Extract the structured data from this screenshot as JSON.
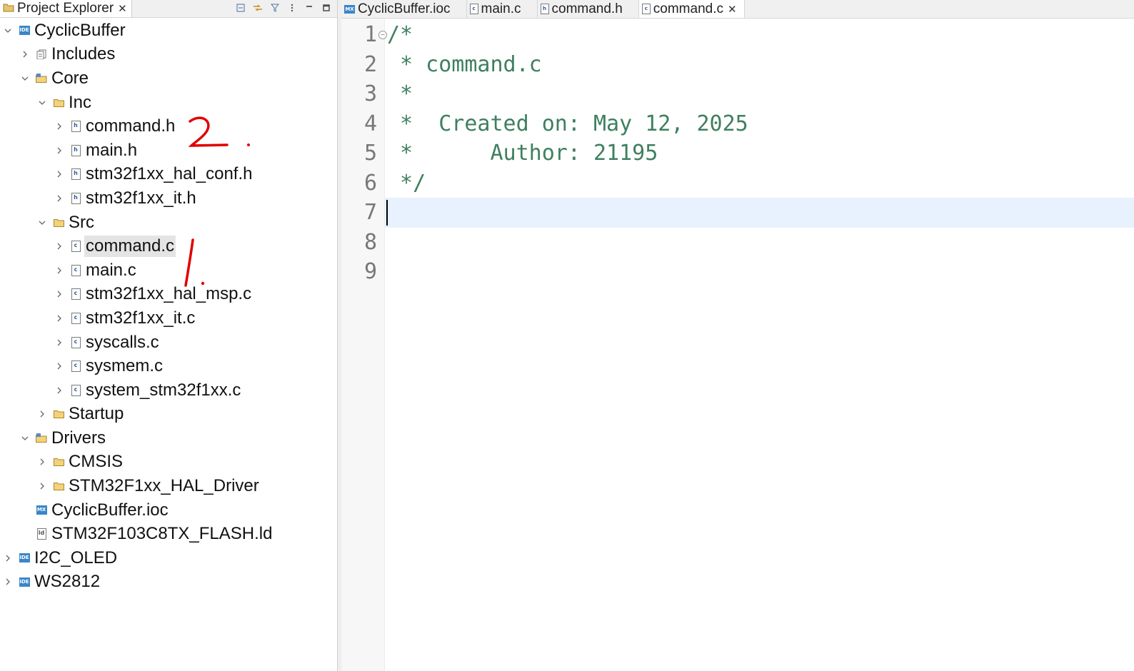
{
  "project_explorer": {
    "tab_label": "Project Explorer",
    "toolbar_icons": [
      "collapse-all-icon",
      "link-with-editor-icon",
      "filter-icon",
      "view-menu-icon",
      "minimize-icon",
      "maximize-icon"
    ],
    "tree": [
      {
        "label": "CyclicBuffer",
        "icon": "ide-project-icon",
        "expanded": true,
        "level": 0
      },
      {
        "label": "Includes",
        "icon": "includes-icon",
        "expanded": false,
        "level": 1
      },
      {
        "label": "Core",
        "icon": "source-folder-icon",
        "expanded": true,
        "level": 1
      },
      {
        "label": "Inc",
        "icon": "folder-icon",
        "expanded": true,
        "level": 2
      },
      {
        "label": "command.h",
        "icon": "header-file-icon",
        "expanded": false,
        "level": 3
      },
      {
        "label": "main.h",
        "icon": "header-file-icon",
        "expanded": false,
        "level": 3
      },
      {
        "label": "stm32f1xx_hal_conf.h",
        "icon": "header-file-icon",
        "expanded": false,
        "level": 3
      },
      {
        "label": "stm32f1xx_it.h",
        "icon": "header-file-icon",
        "expanded": false,
        "level": 3
      },
      {
        "label": "Src",
        "icon": "folder-icon",
        "expanded": true,
        "level": 2
      },
      {
        "label": "command.c",
        "icon": "c-file-icon",
        "expanded": false,
        "level": 3,
        "selected": true
      },
      {
        "label": "main.c",
        "icon": "c-file-icon",
        "expanded": false,
        "level": 3
      },
      {
        "label": "stm32f1xx_hal_msp.c",
        "icon": "c-file-icon",
        "expanded": false,
        "level": 3
      },
      {
        "label": "stm32f1xx_it.c",
        "icon": "c-file-icon",
        "expanded": false,
        "level": 3
      },
      {
        "label": "syscalls.c",
        "icon": "c-file-icon",
        "expanded": false,
        "level": 3
      },
      {
        "label": "sysmem.c",
        "icon": "c-file-icon",
        "expanded": false,
        "level": 3
      },
      {
        "label": "system_stm32f1xx.c",
        "icon": "c-file-icon",
        "expanded": false,
        "level": 3
      },
      {
        "label": "Startup",
        "icon": "folder-icon",
        "expanded": false,
        "level": 2
      },
      {
        "label": "Drivers",
        "icon": "source-folder-icon",
        "expanded": true,
        "level": 1
      },
      {
        "label": "CMSIS",
        "icon": "folder-icon",
        "expanded": false,
        "level": 2
      },
      {
        "label": "STM32F1xx_HAL_Driver",
        "icon": "folder-icon",
        "expanded": false,
        "level": 2
      },
      {
        "label": "CyclicBuffer.ioc",
        "icon": "mx-file-icon",
        "leaf": true,
        "level": 1
      },
      {
        "label": "STM32F103C8TX_FLASH.ld",
        "icon": "ld-file-icon",
        "leaf": true,
        "level": 1
      },
      {
        "label": "I2C_OLED",
        "icon": "ide-project-icon",
        "expanded": false,
        "level": 0
      },
      {
        "label": "WS2812",
        "icon": "ide-project-icon",
        "expanded": false,
        "level": 0
      }
    ],
    "annotations": {
      "mark_1": "1.",
      "mark_2": "2."
    }
  },
  "editor": {
    "tabs": [
      {
        "label": "CyclicBuffer.ioc",
        "icon": "mx-file-icon",
        "active": false
      },
      {
        "label": "main.c",
        "icon": "c-file-icon",
        "active": false
      },
      {
        "label": "command.h",
        "icon": "header-file-icon",
        "active": false
      },
      {
        "label": "command.c",
        "icon": "c-file-icon",
        "active": true,
        "closable": true
      }
    ],
    "current_line": 7,
    "lines": [
      {
        "num": "1",
        "text": "/*"
      },
      {
        "num": "2",
        "text": " * command.c"
      },
      {
        "num": "3",
        "text": " *"
      },
      {
        "num": "4",
        "text": " *  Created on: May 12, 2025"
      },
      {
        "num": "5",
        "text": " *      Author: 21195"
      },
      {
        "num": "6",
        "text": " */"
      },
      {
        "num": "7",
        "text": ""
      },
      {
        "num": "8",
        "text": ""
      },
      {
        "num": "9",
        "text": ""
      }
    ],
    "colors": {
      "comment": "#3f7f5f",
      "current_line_bg": "#e8f2fe",
      "line_number": "#787878"
    }
  }
}
